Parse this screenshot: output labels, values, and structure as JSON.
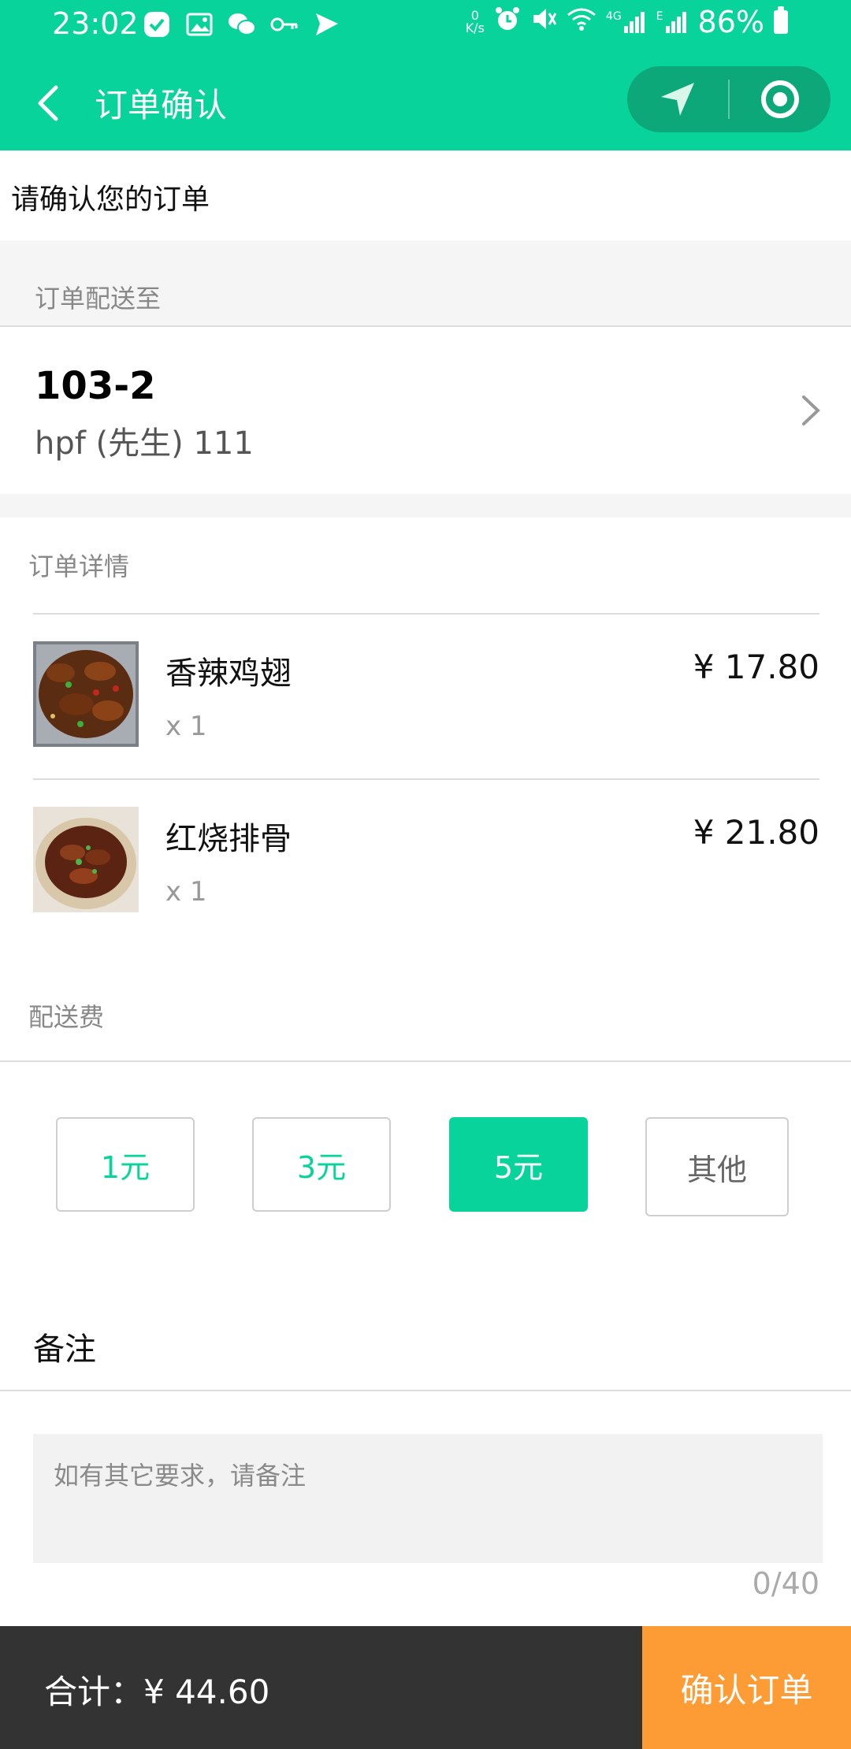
{
  "status_bar": {
    "time": "23:02",
    "net_speed_top": "0",
    "net_speed_unit": "K/s",
    "signal_label": "4G",
    "signal_label2": "E",
    "battery": "86%"
  },
  "nav": {
    "title": "订单确认"
  },
  "page": {
    "heading": "请确认您的订单"
  },
  "delivery": {
    "label": "订单配送至",
    "address": "103-2",
    "contact": "hpf (先生) 111"
  },
  "order": {
    "label": "订单详情",
    "items": [
      {
        "name": "香辣鸡翅",
        "qty": "x 1",
        "price": "¥ 17.80"
      },
      {
        "name": "红烧排骨",
        "qty": "x 1",
        "price": "¥ 21.80"
      }
    ]
  },
  "fee": {
    "label": "配送费",
    "options": [
      "1元",
      "3元",
      "5元",
      "其他"
    ],
    "selected_index": 2
  },
  "remark": {
    "title": "备注",
    "placeholder": "如有其它要求，请备注",
    "count": "0/40"
  },
  "footer": {
    "total": "合计：¥ 44.60",
    "confirm_label": "确认订单"
  },
  "colors": {
    "brand_green": "#07d39b",
    "confirm_orange": "#fd9b35",
    "footer_dark": "#333333"
  }
}
